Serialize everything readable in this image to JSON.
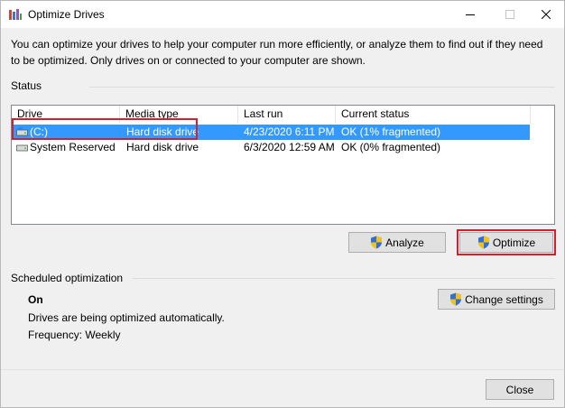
{
  "window": {
    "title": "Optimize Drives",
    "minimize_glyph": "—",
    "close_glyph": "✕"
  },
  "intro_text": "You can optimize your drives to help your computer run more efficiently, or analyze them to find out if they need to be optimized. Only drives on or connected to your computer are shown.",
  "status": {
    "label": "Status",
    "columns": [
      "Drive",
      "Media type",
      "Last run",
      "Current status"
    ],
    "rows": [
      {
        "drive": "(C:)",
        "media_type": "Hard disk drive",
        "last_run": "4/23/2020 6:11 PM",
        "current_status": "OK (1% fragmented)",
        "selected": true
      },
      {
        "drive": "System Reserved",
        "media_type": "Hard disk drive",
        "last_run": "6/3/2020 12:59 AM",
        "current_status": "OK (0% fragmented)",
        "selected": false
      }
    ],
    "analyze_label": "Analyze",
    "optimize_label": "Optimize"
  },
  "scheduled": {
    "label": "Scheduled optimization",
    "state": "On",
    "description": "Drives are being optimized automatically.",
    "frequency": "Frequency: Weekly",
    "change_settings_label": "Change settings"
  },
  "close_label": "Close",
  "colors": {
    "selection": "#3399ff",
    "highlight_box": "#d4202c",
    "shield_blue": "#2f6fd6",
    "shield_yellow": "#f2c21a"
  },
  "icons": {
    "app": "defrag-app-icon",
    "drive": "hard-drive-icon",
    "uac": "uac-shield-icon"
  }
}
